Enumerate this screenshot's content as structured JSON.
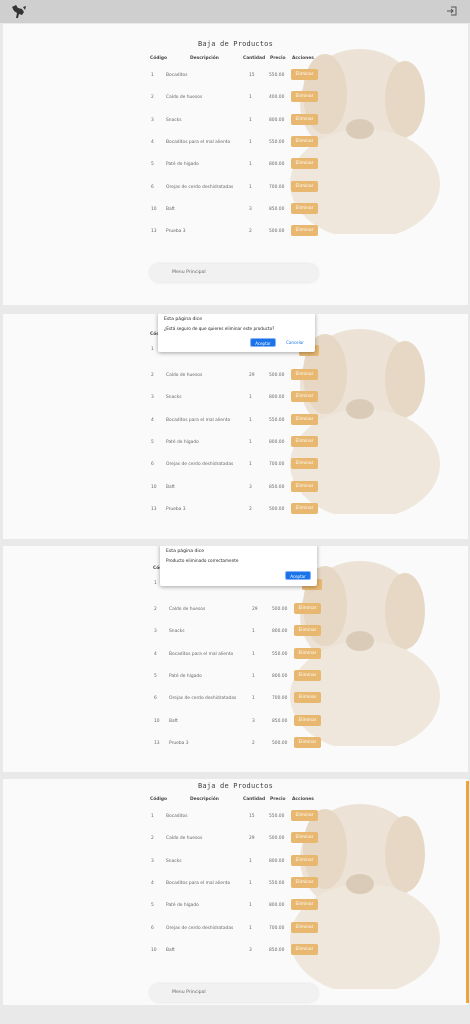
{
  "header": {
    "logo_icon": "dog-logo-icon",
    "exit_icon": "logout-icon"
  },
  "page": {
    "title": "Baja de Productos",
    "columns": [
      "Código",
      "Descripción",
      "Cantidad",
      "Precio",
      "Acciones"
    ],
    "delete_label": "Eliminar",
    "menu_label": "Menu Principal",
    "accent_color": "#e8b870"
  },
  "panel1": {
    "rows": [
      {
        "code": "1",
        "desc": "Bocaditos",
        "qty": "15",
        "price": "550.00"
      },
      {
        "code": "2",
        "desc": "Caldo de huesos",
        "qty": "1",
        "price": "400.00"
      },
      {
        "code": "3",
        "desc": "Snacks",
        "qty": "1",
        "price": "800.00"
      },
      {
        "code": "4",
        "desc": "Bocaditos para el mal aliento",
        "qty": "1",
        "price": "550.00"
      },
      {
        "code": "5",
        "desc": "Paté de hígado",
        "qty": "1",
        "price": "800.00"
      },
      {
        "code": "6",
        "desc": "Orejas de cerdo deshidratadas",
        "qty": "1",
        "price": "700.00"
      },
      {
        "code": "10",
        "desc": "Baft",
        "qty": "3",
        "price": "850.00"
      },
      {
        "code": "13",
        "desc": "Prueba 3",
        "qty": "2",
        "price": "500.00"
      }
    ]
  },
  "panel2": {
    "rows": [
      {
        "code": "2",
        "desc": "Caldo de huesos",
        "qty": "29",
        "price": "500.00"
      },
      {
        "code": "3",
        "desc": "Snacks",
        "qty": "1",
        "price": "800.00"
      },
      {
        "code": "4",
        "desc": "Bocaditos para el mal aliento",
        "qty": "1",
        "price": "550.00"
      },
      {
        "code": "5",
        "desc": "Paté de hígado",
        "qty": "1",
        "price": "800.00"
      },
      {
        "code": "6",
        "desc": "Orejas de cerdo deshidratadas",
        "qty": "1",
        "price": "700.00"
      },
      {
        "code": "10",
        "desc": "Baft",
        "qty": "3",
        "price": "850.00"
      },
      {
        "code": "13",
        "desc": "Prueba 3",
        "qty": "2",
        "price": "500.00"
      }
    ],
    "first_code": "1",
    "header_partial": "Cód",
    "dialog": {
      "title": "Esta página dice",
      "message": "¿Está seguro de que quieres eliminar este producto?",
      "accept": "Aceptar",
      "cancel": "Cancelar"
    }
  },
  "panel3": {
    "rows": [
      {
        "code": "2",
        "desc": "Caldo de huesos",
        "qty": "29",
        "price": "500.00"
      },
      {
        "code": "3",
        "desc": "Snacks",
        "qty": "1",
        "price": "800.00"
      },
      {
        "code": "4",
        "desc": "Bocaditos para el mal aliento",
        "qty": "1",
        "price": "550.00"
      },
      {
        "code": "5",
        "desc": "Paté de hígado",
        "qty": "1",
        "price": "800.00"
      },
      {
        "code": "6",
        "desc": "Orejas de cerdo deshidratadas",
        "qty": "1",
        "price": "700.00"
      },
      {
        "code": "10",
        "desc": "Baft",
        "qty": "3",
        "price": "850.00"
      },
      {
        "code": "13",
        "desc": "Prueba 3",
        "qty": "2",
        "price": "500.00"
      }
    ],
    "first_code": "1",
    "header_partial": "Cód",
    "dialog": {
      "title": "Esta página dice",
      "message": "Producto eliminado correctamente",
      "accept": "Aceptar"
    }
  },
  "panel4": {
    "rows": [
      {
        "code": "1",
        "desc": "Bocaditos",
        "qty": "15",
        "price": "550.00"
      },
      {
        "code": "2",
        "desc": "Caldo de huesos",
        "qty": "29",
        "price": "500.00"
      },
      {
        "code": "3",
        "desc": "Snacks",
        "qty": "1",
        "price": "800.00"
      },
      {
        "code": "4",
        "desc": "Bocaditos para el mal aliento",
        "qty": "1",
        "price": "550.00"
      },
      {
        "code": "5",
        "desc": "Paté de hígado",
        "qty": "1",
        "price": "800.00"
      },
      {
        "code": "6",
        "desc": "Orejas de cerdo deshidratadas",
        "qty": "1",
        "price": "700.00"
      },
      {
        "code": "10",
        "desc": "Baft",
        "qty": "3",
        "price": "850.00"
      }
    ]
  }
}
